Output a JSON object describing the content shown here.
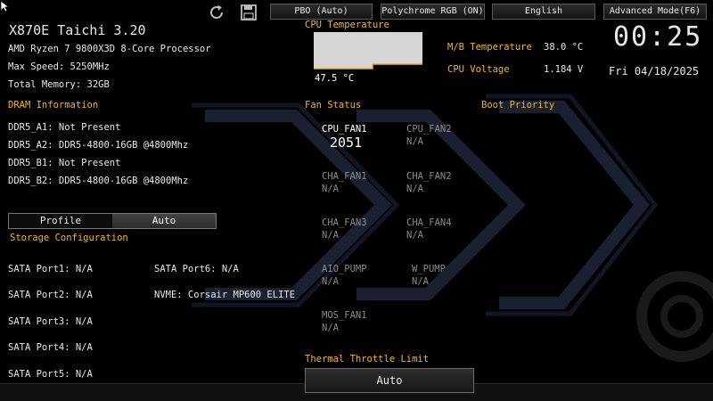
{
  "topbar": {
    "pbo_label": "PBO (Auto)",
    "rgb_label": "Polychrome RGB (ON)",
    "language_label": "English",
    "mode_label": "Advanced Mode(F6)",
    "refresh_icon": "refresh-icon",
    "save_icon": "save-icon"
  },
  "system": {
    "board_title": "X870E Taichi 3.20",
    "cpu_name": "AMD Ryzen 7 9800X3D 8-Core Processor",
    "max_speed": "Max Speed: 5250MHz",
    "total_memory": "Total Memory: 32GB"
  },
  "dram": {
    "heading": "DRAM Information",
    "slots": [
      "DDR5_A1: Not Present",
      "DDR5_A2: DDR5-4800-16GB @4800Mhz",
      "DDR5_B1: Not Present",
      "DDR5_B2: DDR5-4800-16GB @4800Mhz"
    ]
  },
  "profile_toggle": {
    "left": "Profile",
    "right": "Auto"
  },
  "storage": {
    "heading": "Storage Configuration",
    "left": [
      "SATA Port1: N/A",
      "SATA Port2: N/A",
      "SATA Port3: N/A",
      "SATA Port4: N/A",
      "SATA Port5: N/A"
    ],
    "right": [
      "SATA Port6: N/A",
      "NVME: Corsair MP600 ELITE"
    ]
  },
  "cpu_temp": {
    "heading": "CPU Temperature",
    "value": "47.5 °C"
  },
  "fan_status": {
    "heading": "Fan Status",
    "fans": [
      {
        "name": "CPU_FAN1",
        "value": "2051"
      },
      {
        "name": "CPU_FAN2",
        "value": "N/A"
      },
      {
        "name": "CHA_FAN1",
        "value": "N/A"
      },
      {
        "name": "CHA_FAN2",
        "value": "N/A"
      },
      {
        "name": "CHA_FAN3",
        "value": "N/A"
      },
      {
        "name": "CHA_FAN4",
        "value": "N/A"
      },
      {
        "name": "AIO_PUMP",
        "value": "N/A"
      },
      {
        "name": "W_PUMP",
        "value": "N/A"
      },
      {
        "name": "MOS_FAN1",
        "value": "N/A"
      }
    ]
  },
  "thermal": {
    "heading": "Thermal Throttle Limit",
    "value": "Auto"
  },
  "sensors": {
    "mb_temp_label": "M/B Temperature",
    "mb_temp_value": "38.0 °C",
    "cpu_voltage_label": "CPU Voltage",
    "cpu_voltage_value": "1.184 V"
  },
  "clock": {
    "time": "00:25",
    "date": "Fri 04/18/2025"
  },
  "boot": {
    "heading": "Boot Priority"
  },
  "colors": {
    "accent": "#f2b612",
    "text": "#e8e8e8",
    "muted": "#8a8a8a",
    "background": "#000000"
  }
}
